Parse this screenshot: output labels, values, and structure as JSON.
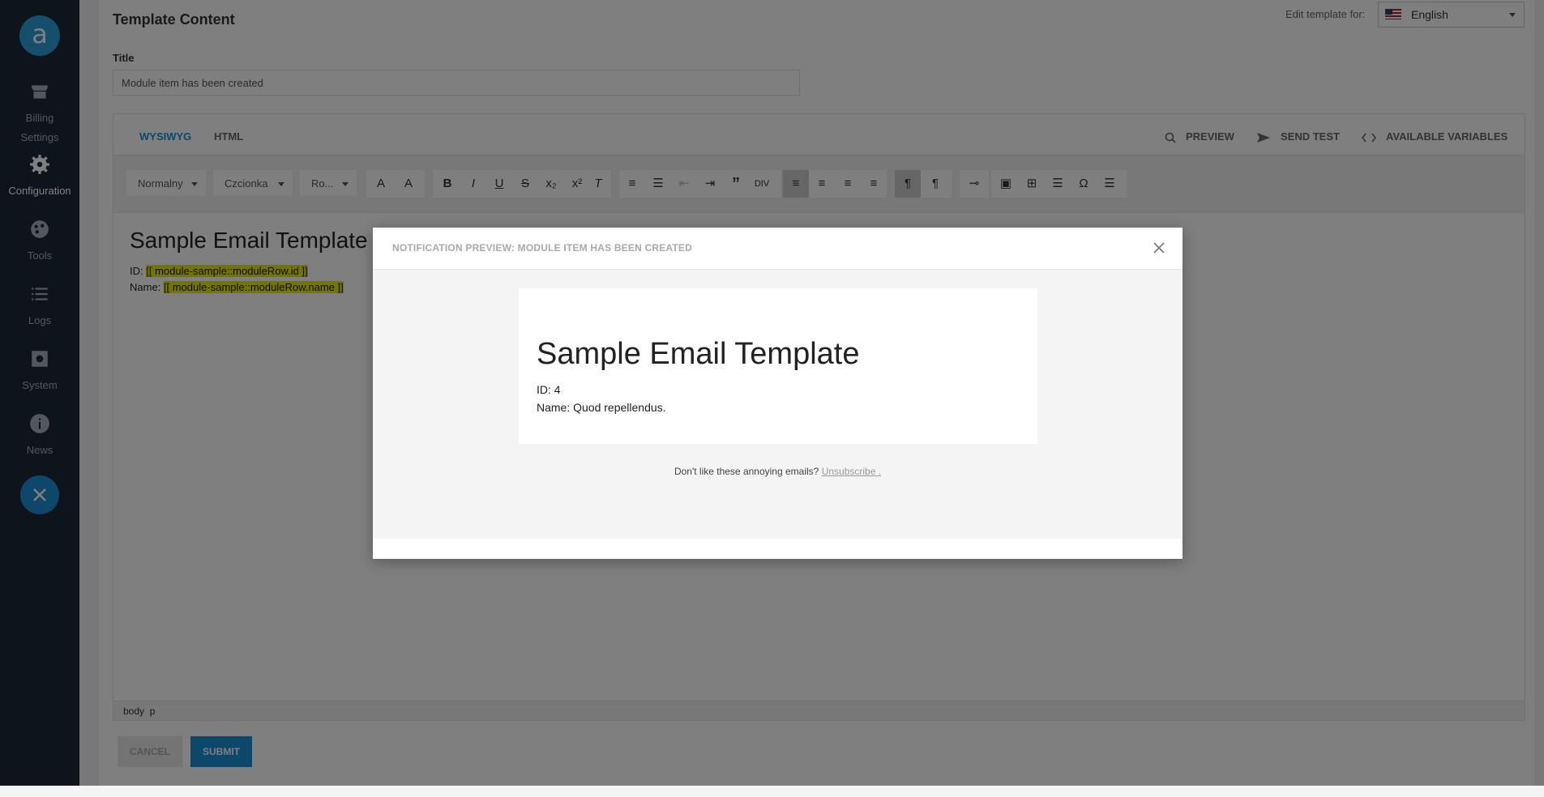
{
  "sidebar": {
    "items": [
      {
        "label": "Billing",
        "icon": "store-icon"
      },
      {
        "label": "Settings",
        "icon": "none"
      },
      {
        "label": "Configuration",
        "icon": "gear-icon"
      },
      {
        "label": "Tools",
        "icon": "palette-icon"
      },
      {
        "label": "Logs",
        "icon": "list-icon"
      },
      {
        "label": "System",
        "icon": "chip-icon"
      },
      {
        "label": "News",
        "icon": "info-icon"
      }
    ]
  },
  "header": {
    "title": "Template Content",
    "edit_for_label": "Edit template for:",
    "language": "English"
  },
  "form": {
    "title_label": "Title",
    "title_value": "Module item has been created"
  },
  "editor": {
    "tabs": [
      {
        "label": "WYSIWYG",
        "active": true
      },
      {
        "label": "HTML",
        "active": false
      }
    ],
    "actions": {
      "preview": "PREVIEW",
      "send_test": "SEND TEST",
      "variables": "AVAILABLE VARIABLES"
    },
    "toolbar": {
      "format": "Normalny",
      "font": "Czcionka",
      "size": "Ro..."
    },
    "content": {
      "heading": "Sample Email Template",
      "id_label": "ID: ",
      "id_var": "[[ module-sample::moduleRow.id ]]",
      "name_label": "Name: ",
      "name_var": "[[ module-sample::moduleRow.name ]]"
    },
    "status_path": "body  p"
  },
  "buttons": {
    "cancel": "CANCEL",
    "submit": "SUBMIT"
  },
  "modal": {
    "title": "NOTIFICATION PREVIEW: MODULE ITEM HAS BEEN CREATED",
    "email": {
      "heading": "Sample Email Template",
      "id_line": "ID: 4",
      "name_line": "Name: Quod repellendus."
    },
    "unsubscribe_text": "Don't like these annoying emails?",
    "unsubscribe_link": "Unsubscribe ."
  },
  "colors": {
    "sidebar_bg": "#1d2838",
    "accent": "#1a8fd4",
    "highlight": "#e8e800"
  }
}
